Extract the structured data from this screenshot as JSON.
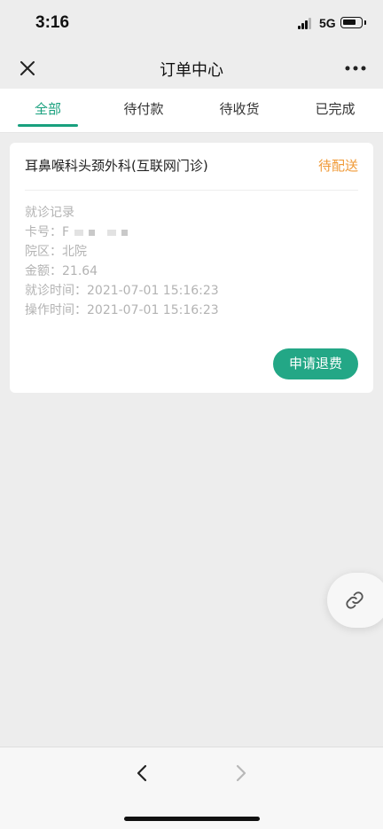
{
  "status_bar": {
    "time": "3:16",
    "network": "5G"
  },
  "header": {
    "title": "订单中心"
  },
  "tabs": [
    {
      "label": "全部",
      "active": true
    },
    {
      "label": "待付款",
      "active": false
    },
    {
      "label": "待收货",
      "active": false
    },
    {
      "label": "已完成",
      "active": false
    }
  ],
  "order": {
    "department": "耳鼻喉科头颈外科(互联网门诊)",
    "status": "待配送",
    "record_label": "就诊记录",
    "card_label": "卡号：",
    "card_value": "F",
    "district": "院区：北院",
    "amount": "金额：21.64",
    "visit_time": "就诊时间：2021-07-01 15:16:23",
    "operate_time": "操作时间：2021-07-01 15:16:23",
    "refund_label": "申请退费"
  },
  "icons": {
    "close": "close-icon",
    "more": "more-icon",
    "link": "link-icon",
    "back": "chevron-left-icon",
    "forward": "chevron-right-icon"
  },
  "colors": {
    "accent": "#18a07e",
    "status_pending": "#f09a37",
    "button": "#23a786"
  }
}
